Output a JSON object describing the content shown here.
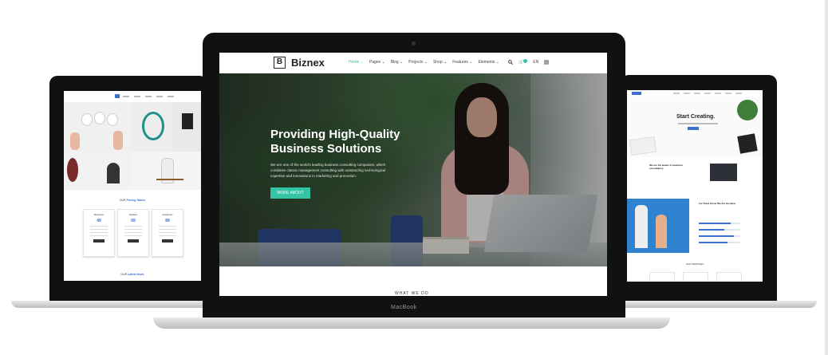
{
  "center_site": {
    "logo_letter": "B",
    "logo_text": "Biznex",
    "menu": [
      "Home ⌄",
      "Pages ⌄",
      "Blog ⌄",
      "Projects ⌄",
      "Shop ⌄",
      "Features ⌄",
      "Elements ⌄"
    ],
    "lang": "EN",
    "hero_title_line1": "Providing High-Quality",
    "hero_title_line2": "Business Solutions",
    "hero_text": "We are one of the world's leading business consulting companies, which combines classic management consulting with outstanding technological expertise and innovations in marketing and promotion.",
    "hero_button": "MORE ABOUT",
    "section_heading": "WHAT WE DO"
  },
  "laptop_brand": "MacBook",
  "left_site": {
    "pricing_heading_prefix": "OUR",
    "pricing_heading": "Pricing Tables",
    "plans": [
      {
        "name": "Business",
        "price": "49"
      },
      {
        "name": "Student",
        "price": "69"
      },
      {
        "name": "Academic",
        "price": "89"
      }
    ],
    "latest_prefix": "OUR",
    "latest_heading": "Latest News"
  },
  "right_site": {
    "hero_title": "Start Creating.",
    "section2_title": "We are the leader in business consultancy",
    "section3_title": "Let Them Know We Are the Best",
    "services_heading": "OUR SERVICES"
  }
}
